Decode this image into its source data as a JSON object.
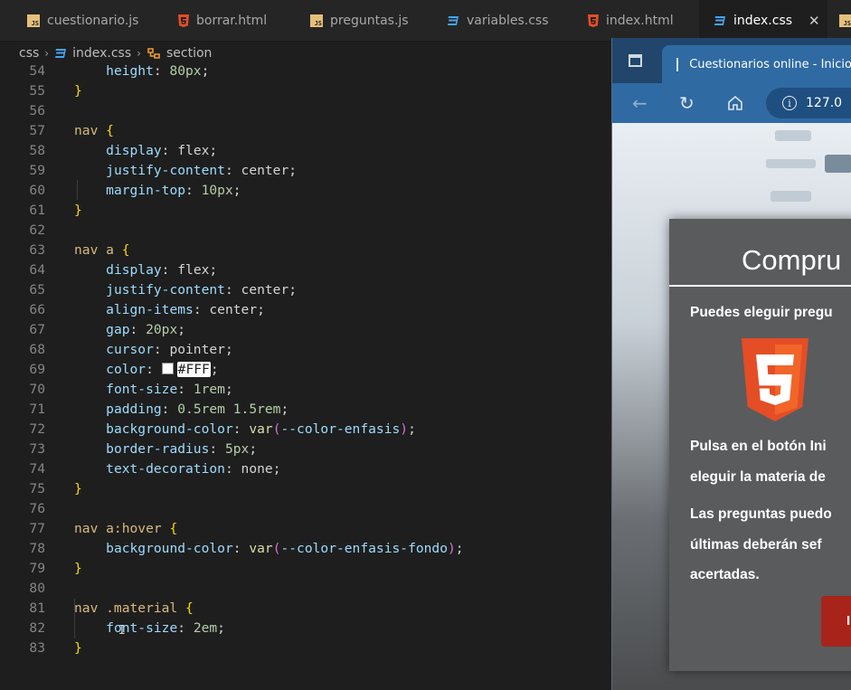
{
  "tabs": [
    {
      "label": "cuestionario.js",
      "type": "js",
      "active": false
    },
    {
      "label": "borrar.html",
      "type": "html",
      "active": false
    },
    {
      "label": "preguntas.js",
      "type": "js",
      "active": false
    },
    {
      "label": "variables.css",
      "type": "css",
      "active": false
    },
    {
      "label": "index.html",
      "type": "html",
      "active": false
    },
    {
      "label": "index.css",
      "type": "css",
      "active": true
    },
    {
      "label": "",
      "type": "js",
      "active": false
    }
  ],
  "breadcrumb": {
    "folder": "css",
    "file": "index.css",
    "symbol": "section"
  },
  "code_lines": {
    "l54": {
      "n": "54",
      "prop": "height",
      "num": "80px"
    },
    "l55": {
      "n": "55"
    },
    "l56": {
      "n": "56"
    },
    "l57": {
      "n": "57",
      "selector": "nav"
    },
    "l58": {
      "n": "58",
      "prop": "display",
      "val": "flex"
    },
    "l59": {
      "n": "59",
      "prop": "justify-content",
      "val": "center"
    },
    "l60": {
      "n": "60",
      "prop": "margin-top",
      "num": "10px"
    },
    "l61": {
      "n": "61"
    },
    "l62": {
      "n": "62"
    },
    "l63": {
      "n": "63",
      "selector": "nav a"
    },
    "l64": {
      "n": "64",
      "prop": "display",
      "val": "flex"
    },
    "l65": {
      "n": "65",
      "prop": "justify-content",
      "val": "center"
    },
    "l66": {
      "n": "66",
      "prop": "align-items",
      "val": "center"
    },
    "l67": {
      "n": "67",
      "prop": "gap",
      "num": "20px"
    },
    "l68": {
      "n": "68",
      "prop": "cursor",
      "val": "pointer"
    },
    "l69": {
      "n": "69",
      "prop": "color",
      "val": "#FFF"
    },
    "l70": {
      "n": "70",
      "prop": "font-size",
      "num": "1rem"
    },
    "l71": {
      "n": "71",
      "prop": "padding",
      "num": "0.5rem 1.5rem"
    },
    "l72": {
      "n": "72",
      "prop": "background-color",
      "fn": "var",
      "var": "--color-enfasis"
    },
    "l73": {
      "n": "73",
      "prop": "border-radius",
      "num": "5px"
    },
    "l74": {
      "n": "74",
      "prop": "text-decoration",
      "val": "none"
    },
    "l75": {
      "n": "75"
    },
    "l76": {
      "n": "76"
    },
    "l77": {
      "n": "77",
      "selector": "nav a:hover"
    },
    "l78": {
      "n": "78",
      "prop": "background-color",
      "fn": "var",
      "var": "--color-enfasis-fondo"
    },
    "l79": {
      "n": "79"
    },
    "l80": {
      "n": "80"
    },
    "l81": {
      "n": "81",
      "selector": "nav .material"
    },
    "l82": {
      "n": "82",
      "prop": "font-size",
      "num": "2em"
    },
    "l83": {
      "n": "83"
    }
  },
  "browser": {
    "tab_title": "Cuestionarios online - Inicio",
    "url": "127.0",
    "card": {
      "title": "Compru",
      "line1": "Puedes eleguir pregu",
      "line2": "Pulsa en el botón Ini",
      "line3": "eleguir la materia de",
      "line4": "Las preguntas puedo",
      "line5": "últimas deberán sef",
      "line6": "acertadas.",
      "button_label": "I"
    }
  },
  "colors": {
    "editor_bg": "#1e1e1e",
    "tabbar_bg": "#252526",
    "browser_chrome": "#2f6aa3",
    "button_red": "#a8231a",
    "html5_orange": "#e44d26"
  }
}
